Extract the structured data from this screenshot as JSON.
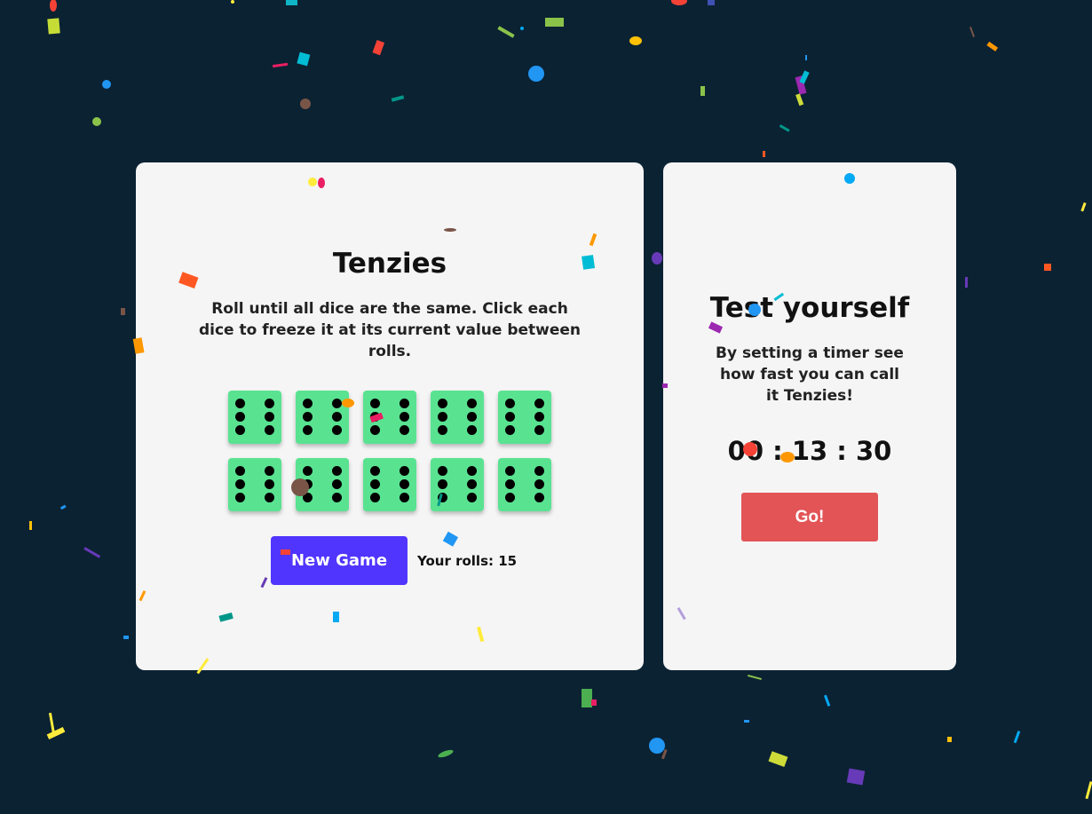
{
  "game": {
    "title": "Tenzies",
    "instructions": "Roll until all dice are the same. Click each dice to freeze it at its current value between rolls.",
    "dice": [
      6,
      6,
      6,
      6,
      6,
      6,
      6,
      6,
      6,
      6
    ],
    "new_game_label": "New Game",
    "rolls_text": "Your rolls: 15"
  },
  "timer_panel": {
    "title": "Test yourself",
    "description": "By setting a timer see how fast you can call it Tenzies!",
    "timer_display": "00 : 13 : 30",
    "go_label": "Go!"
  },
  "colors": {
    "background": "#0b2233",
    "card": "#f5f5f5",
    "die": "#59e391",
    "new_game_button": "#5035ff",
    "go_button": "#e35456"
  }
}
